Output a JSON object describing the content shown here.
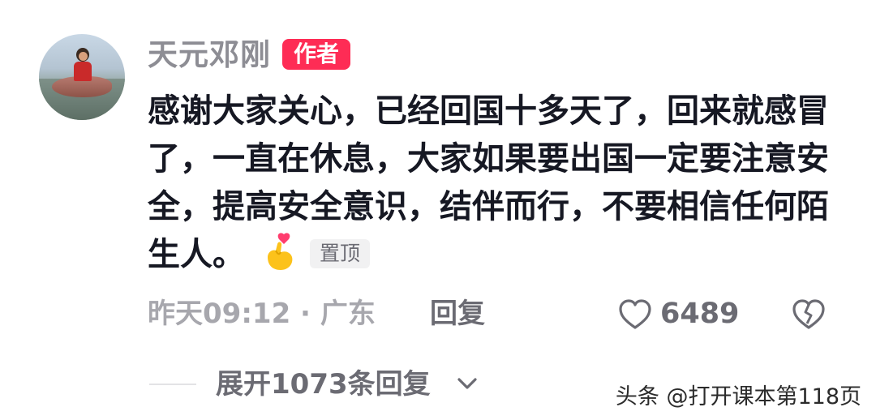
{
  "comment": {
    "username": "天元邓刚",
    "author_badge": "作者",
    "text": "感谢大家关心，已经回国十多天了，回来就感冒了，一直在休息，大家如果要出国一定要注意安全，提高安全意识，结伴而行，不要相信任何陌生人。",
    "emoji": "hand-heart-emoji",
    "pin_label": "置顶",
    "time_location": "昨天09:12 · 广东",
    "reply_label": "回复",
    "like_count": "6489",
    "expand_replies": "展开1073条回复"
  },
  "watermark": "头条 @打开课本第118页",
  "colors": {
    "badge_red": "#fe2c55",
    "text_dark": "#161823",
    "text_gray": "#8d8d94"
  }
}
